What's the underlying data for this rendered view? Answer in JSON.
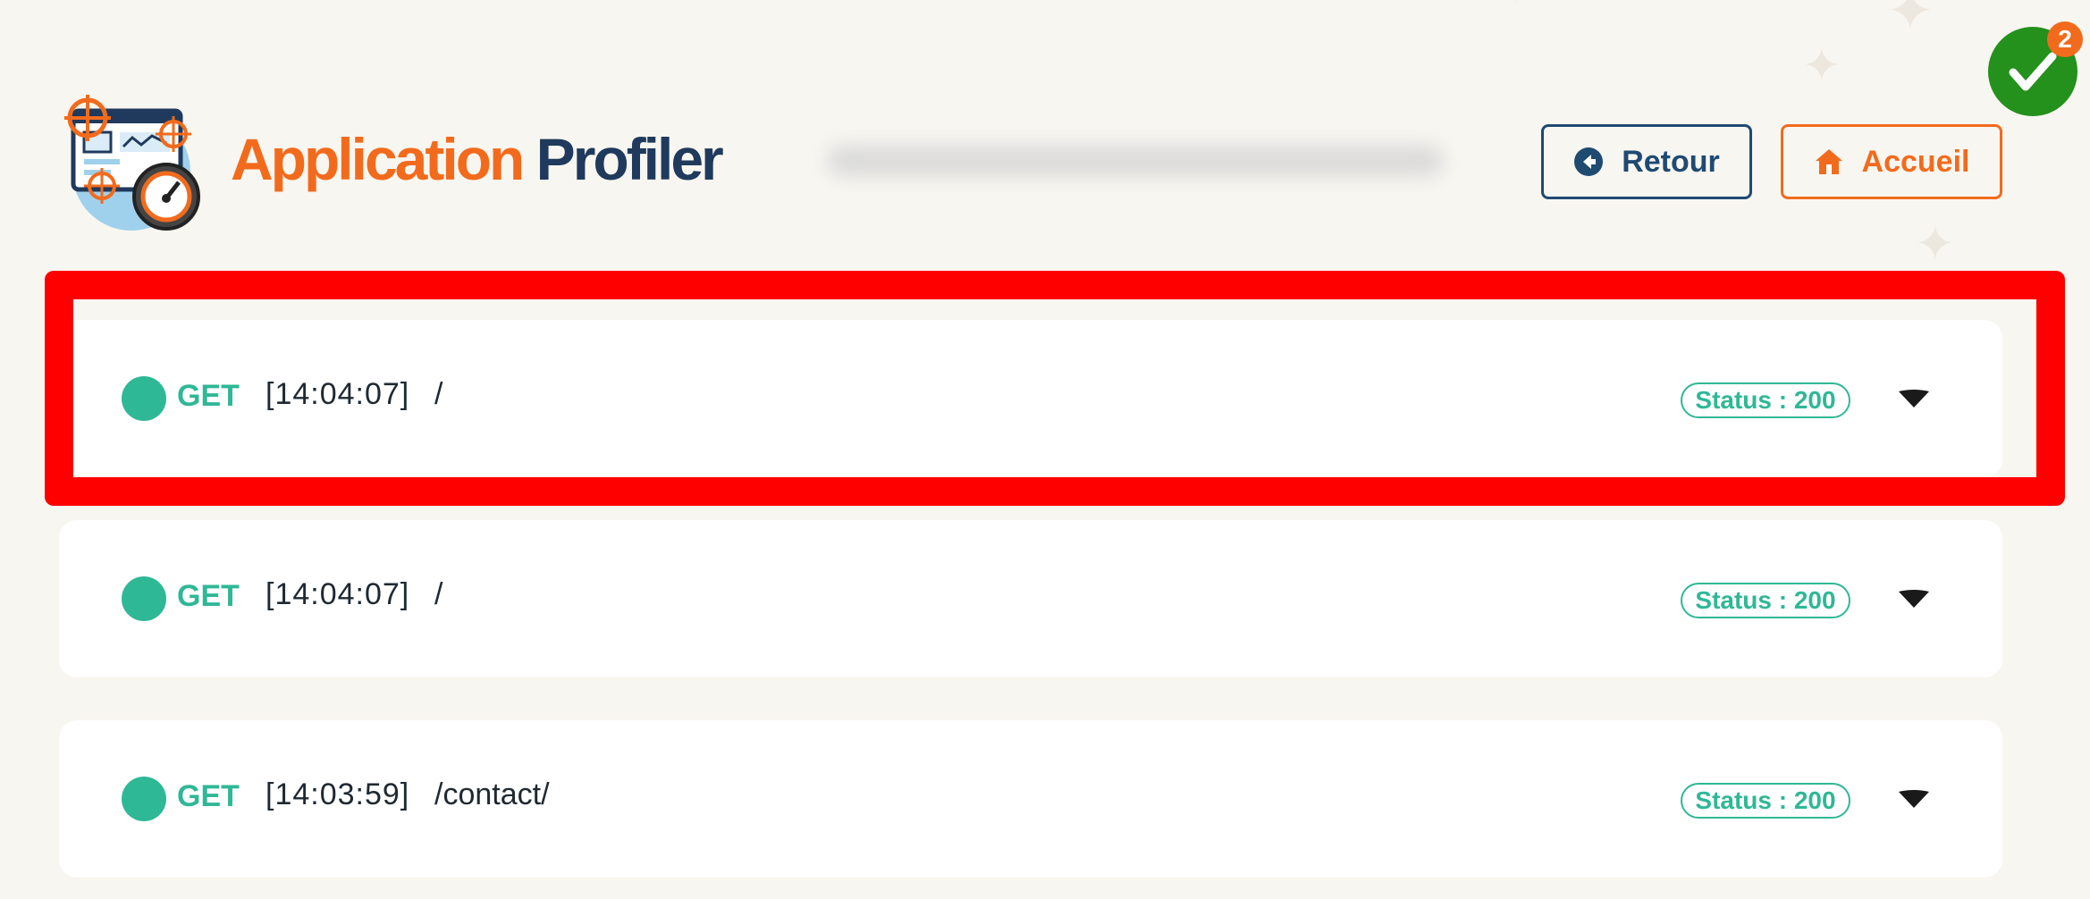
{
  "app": {
    "title_part1": "Application",
    "title_part2": "Profiler"
  },
  "nav": {
    "back_label": "Retour",
    "home_label": "Accueil"
  },
  "notifications": {
    "count": "2"
  },
  "colors": {
    "brand_orange": "#f26b1d",
    "brand_navy": "#1f3a5c",
    "success_green": "#2fb896",
    "highlight_red": "#ff0000",
    "badge_green": "#23911b"
  },
  "requests": [
    {
      "method": "GET",
      "time": "[14:04:07]",
      "path": "/",
      "status": "Status : 200"
    },
    {
      "method": "GET",
      "time": "[14:04:07]",
      "path": "/",
      "status": "Status : 200"
    },
    {
      "method": "GET",
      "time": "[14:03:59]",
      "path": "/contact/",
      "status": "Status : 200"
    }
  ]
}
